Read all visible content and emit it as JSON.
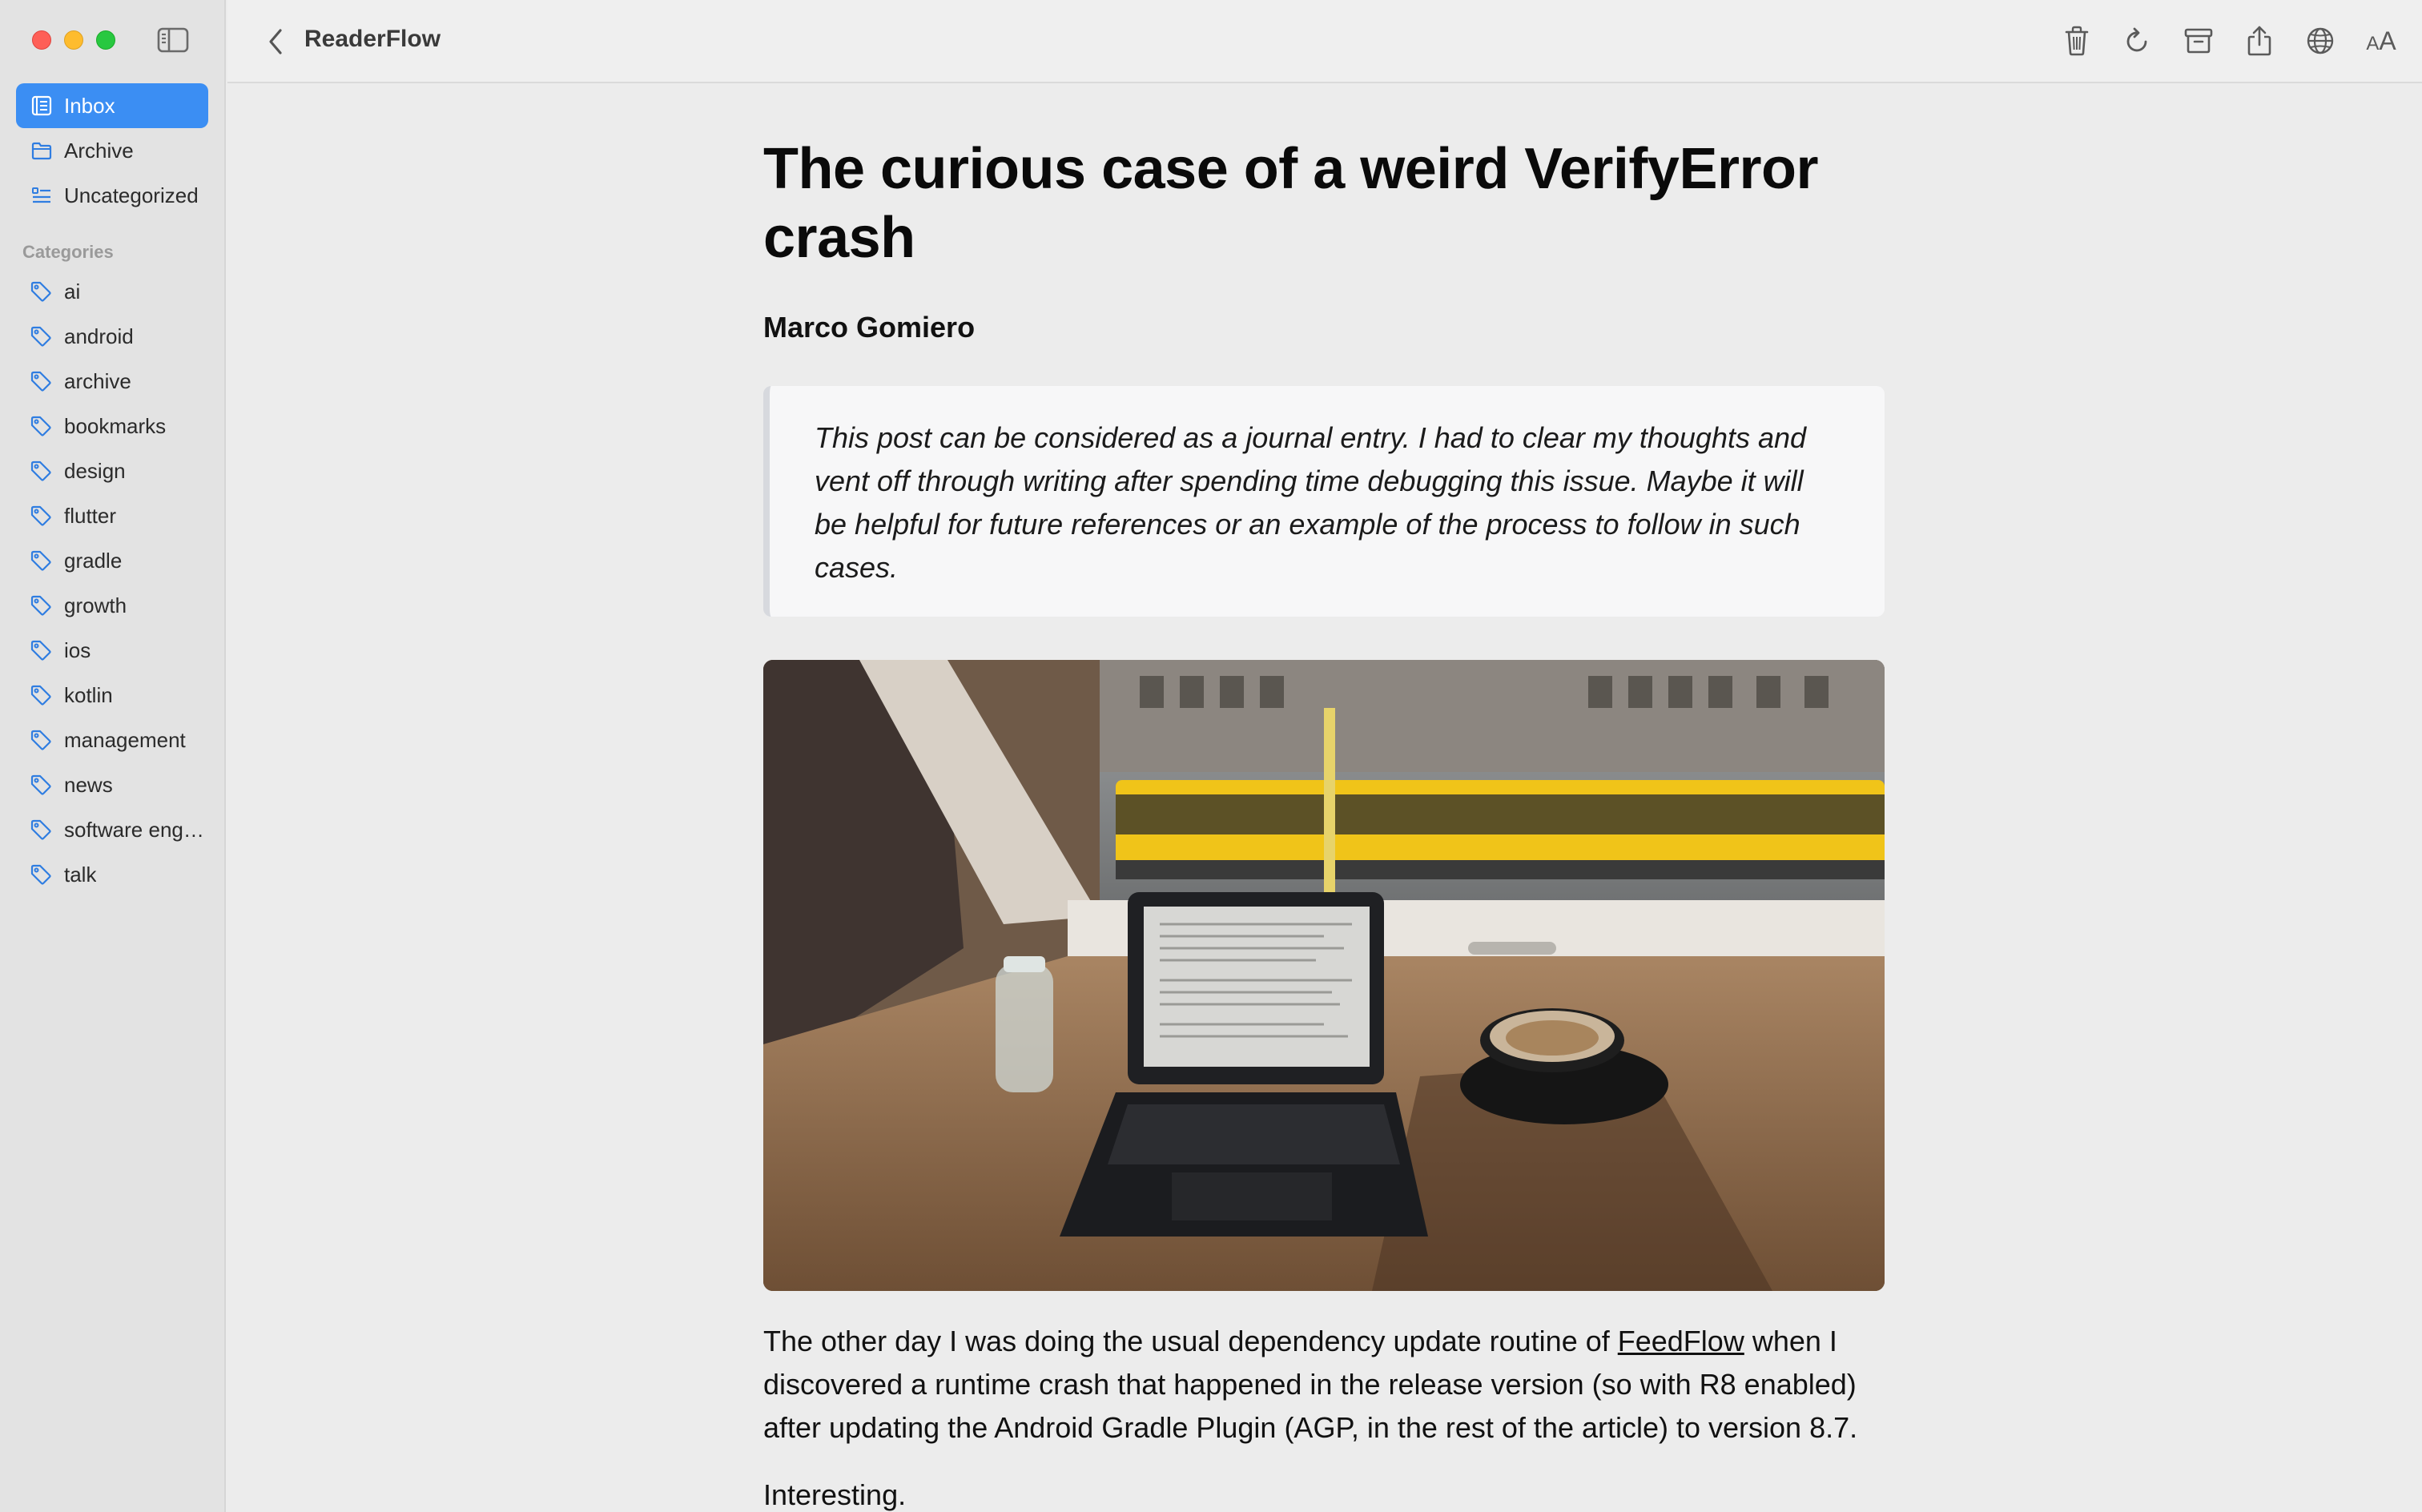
{
  "app": {
    "title": "ReaderFlow"
  },
  "sidebar": {
    "nav": [
      {
        "label": "Inbox",
        "icon": "inbox-icon",
        "active": true
      },
      {
        "label": "Archive",
        "icon": "folder-icon",
        "active": false
      },
      {
        "label": "Uncategorized",
        "icon": "list-icon",
        "active": false
      }
    ],
    "categories_header": "Categories",
    "categories": [
      "ai",
      "android",
      "archive",
      "bookmarks",
      "design",
      "flutter",
      "gradle",
      "growth",
      "ios",
      "kotlin",
      "management",
      "news",
      "software engineering",
      "talk"
    ]
  },
  "toolbar": {
    "font_size_label": "AA",
    "actions": [
      "trash-icon",
      "refresh-icon",
      "archive-box-icon",
      "share-icon",
      "globe-icon",
      "text-size-icon"
    ]
  },
  "article": {
    "title": "The curious case of a weird VerifyError crash",
    "author": "Marco Gomiero",
    "quote": "This post can be considered as a journal entry. I had to clear my thoughts and vent off through writing after spending time debugging this issue. Maybe it will be helpful for future references or an example of the process to follow in such cases.",
    "paragraph1_before": "The other day I was doing the usual dependency update routine of ",
    "paragraph1_link": "FeedFlow",
    "paragraph1_after": " when I discovered a runtime crash that happened in the release version (so with R8 enabled) after updating the Android Gradle Plugin (AGP, in the rest of the article) to version 8.7.",
    "paragraph2": "Interesting."
  },
  "colors": {
    "accent": "#3b8ef3",
    "sidebar_bg": "#e3e3e3",
    "content_bg": "#ececec"
  }
}
